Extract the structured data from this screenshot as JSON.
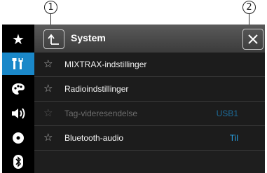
{
  "callouts": {
    "left": "1",
    "right": "2"
  },
  "sidebar": {
    "items": [
      {
        "icon": "star-icon",
        "active": false
      },
      {
        "icon": "settings-tools-icon",
        "active": true
      },
      {
        "icon": "palette-icon",
        "active": false
      },
      {
        "icon": "speaker-icon",
        "active": false
      },
      {
        "icon": "disc-icon",
        "active": false
      },
      {
        "icon": "bluetooth-icon",
        "active": false
      }
    ]
  },
  "header": {
    "title": "System"
  },
  "list": {
    "items": [
      {
        "label": "MIXTRAX-indstillinger",
        "value": "",
        "enabled": true
      },
      {
        "label": "Radioindstillinger",
        "value": "",
        "enabled": true
      },
      {
        "label": "Tag-videresendelse",
        "value": "USB1",
        "enabled": false
      },
      {
        "label": "Bluetooth-audio",
        "value": "Til",
        "enabled": true
      }
    ]
  },
  "colors": {
    "accent": "#1a88c9",
    "value_text": "#29a3e6",
    "background": "#1e1e1e"
  }
}
